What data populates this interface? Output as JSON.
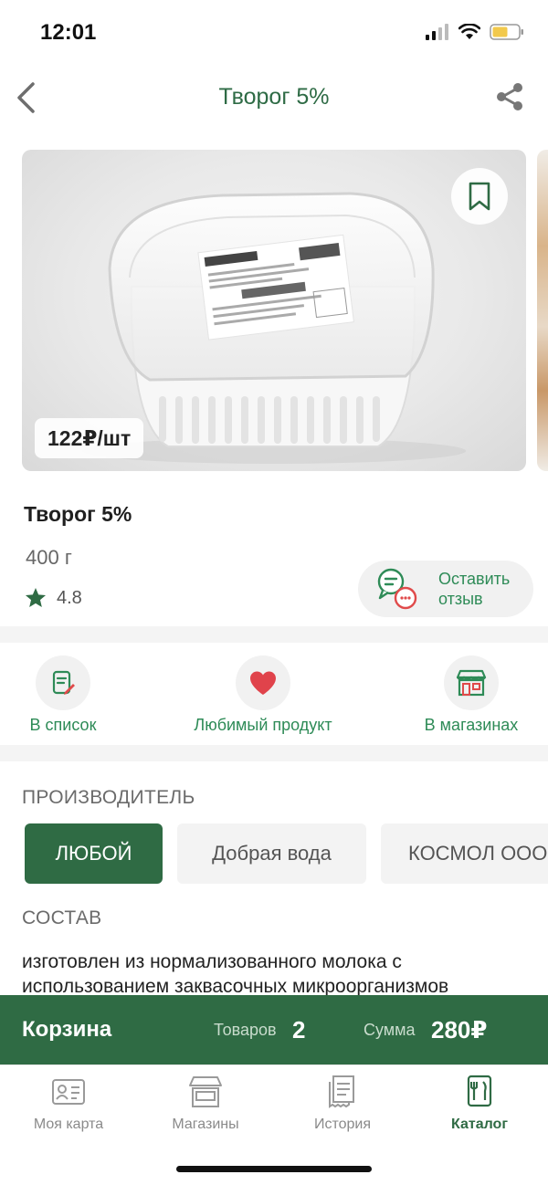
{
  "status_bar": {
    "time": "12:01"
  },
  "header": {
    "title": "Творог 5%"
  },
  "product": {
    "name": "Творог 5%",
    "weight": "400 г",
    "price": "122₽/шт",
    "rating": "4.8",
    "review_button": {
      "line1": "Оставить",
      "line2": "отзыв"
    }
  },
  "actions": [
    {
      "label": "В список",
      "icon": "list-edit-icon"
    },
    {
      "label": "Любимый продукт",
      "icon": "heart-icon"
    },
    {
      "label": "В магазинах",
      "icon": "store-icon"
    }
  ],
  "manufacturer": {
    "title": "ПРОИЗВОДИТЕЛЬ",
    "chips": [
      "ЛЮБОЙ",
      "Добрая вода",
      "КОСМОЛ ООО"
    ],
    "selected": "ЛЮБОЙ"
  },
  "composition": {
    "title": "СОСТАВ",
    "text": "изготовлен из нормализованного молока с использованием заквасочных микроорганизмов"
  },
  "cart": {
    "title": "Корзина",
    "items_label": "Товаров",
    "items_count": "2",
    "sum_label": "Сумма",
    "sum_value": "280₽"
  },
  "tabs": [
    {
      "label": "Моя карта",
      "icon": "card-icon",
      "active": false
    },
    {
      "label": "Магазины",
      "icon": "store-icon",
      "active": false
    },
    {
      "label": "История",
      "icon": "receipt-icon",
      "active": false
    },
    {
      "label": "Каталог",
      "icon": "catalog-icon",
      "active": true
    }
  ],
  "colors": {
    "primary_green": "#2f6b44",
    "accent_green": "#2e8b57",
    "heart_red": "#e0434b",
    "review_red": "#e04a4a"
  }
}
